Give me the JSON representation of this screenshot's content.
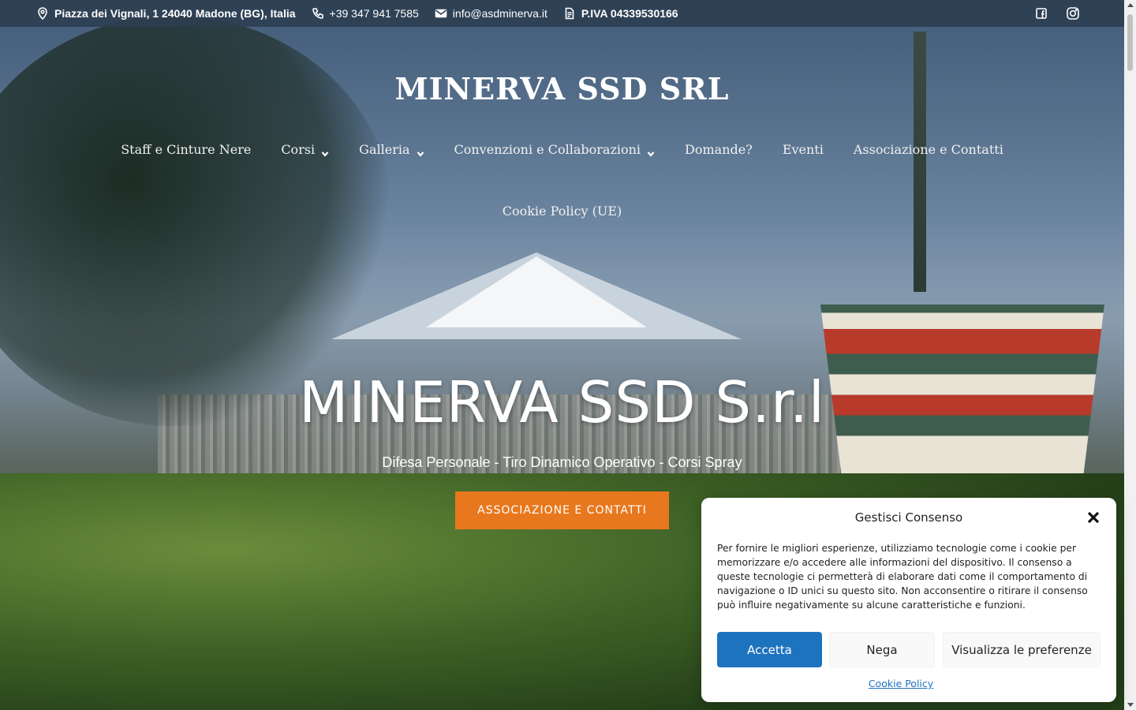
{
  "topbar": {
    "address": "Piazza dei Vignali, 1 24040 Madone (BG), Italia",
    "phone": "+39 347 941 7585",
    "email": "info@asdminerva.it",
    "vat": "P.IVA 04339530166",
    "icons": [
      "map-pin-icon",
      "phone-icon",
      "mail-icon",
      "document-icon",
      "facebook-icon",
      "instagram-icon"
    ]
  },
  "site": {
    "title": "MINERVA SSD SRL"
  },
  "nav": {
    "items": [
      {
        "label": "Staff e Cinture Nere",
        "has_dropdown": false
      },
      {
        "label": "Corsi",
        "has_dropdown": true
      },
      {
        "label": "Galleria",
        "has_dropdown": true
      },
      {
        "label": "Convenzioni e Collaborazioni",
        "has_dropdown": true
      },
      {
        "label": "Domande?",
        "has_dropdown": false
      },
      {
        "label": "Eventi",
        "has_dropdown": false
      },
      {
        "label": "Associazione e Contatti",
        "has_dropdown": false
      }
    ],
    "second_row": "Cookie Policy (UE)"
  },
  "hero": {
    "title": "MINERVA SSD S.r.l",
    "subtitle": "Difesa Personale - Tiro Dinamico Operativo - Corsi Spray",
    "cta_label": "ASSOCIAZIONE E CONTATTI",
    "cta_color": "#e8781d"
  },
  "cookie": {
    "title": "Gestisci Consenso",
    "text": "Per fornire le migliori esperienze, utilizziamo tecnologie come i cookie per memorizzare e/o accedere alle informazioni del dispositivo. Il consenso a queste tecnologie ci permetterà di elaborare dati come il comportamento di navigazione o ID unici su questo sito. Non acconsentire o ritirare il consenso può influire negativamente su alcune caratteristiche e funzioni.",
    "accept_label": "Accetta",
    "deny_label": "Nega",
    "prefs_label": "Visualizza le preferenze",
    "policy_link": "Cookie Policy",
    "accept_color": "#1e73be"
  }
}
